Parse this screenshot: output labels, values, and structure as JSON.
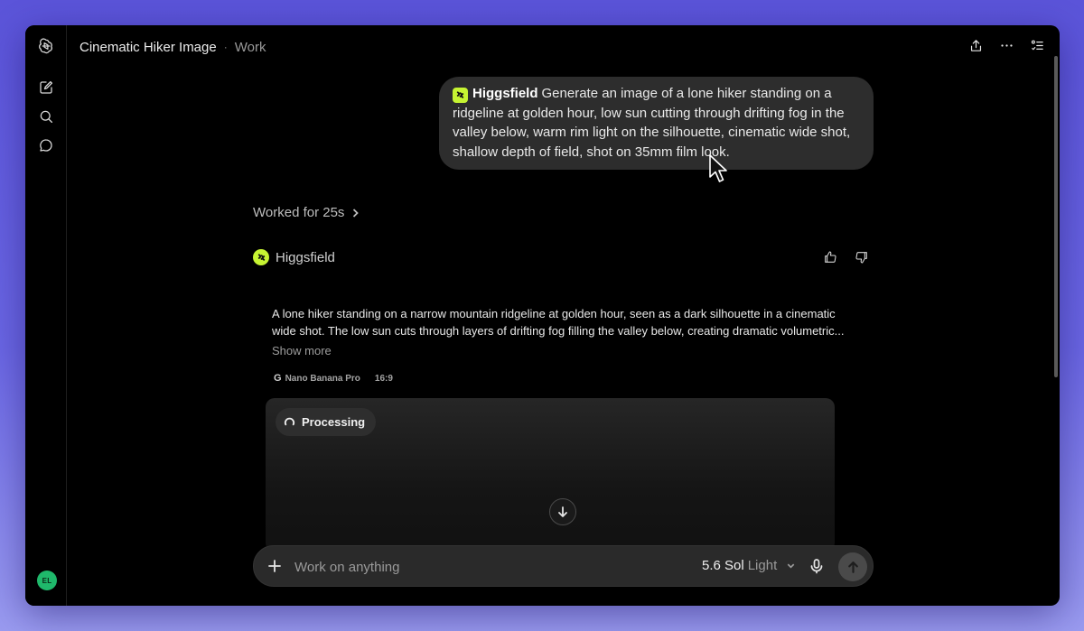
{
  "header": {
    "title": "Cinematic Hiker Image",
    "separator": "·",
    "project": "Work"
  },
  "user": {
    "avatar_initials": "EL",
    "avatar_color": "#1fb86b"
  },
  "message": {
    "mention": "Higgsfield",
    "text": "Generate an image of a lone hiker standing on a ridgeline at golden hour, low sun cutting through drifting fog in the valley below, warm rim light on the silhouette, cinematic wide shot, shallow depth of field, shot on 35mm film look."
  },
  "response": {
    "worked_label": "Worked for 25s",
    "agent_name": "Higgsfield",
    "description_line1": "A lone hiker standing on a narrow mountain ridgeline at golden hour, seen as a dark silhouette in a cinematic",
    "description_line2": "wide shot. The low sun cuts through layers of drifting fog filling the valley below, creating dramatic volumetric...",
    "show_more": "Show more",
    "model_tag": "Nano Banana Pro",
    "model_tag_icon": "G",
    "aspect_ratio": "16:9",
    "status": "Processing"
  },
  "composer": {
    "placeholder": "Work on anything",
    "model_name": "5.6 Sol",
    "model_variant": "Light"
  },
  "colors": {
    "accent_brand": "#c6f432",
    "window_bg": "#000000",
    "bubble_bg": "#2d2d2d"
  }
}
